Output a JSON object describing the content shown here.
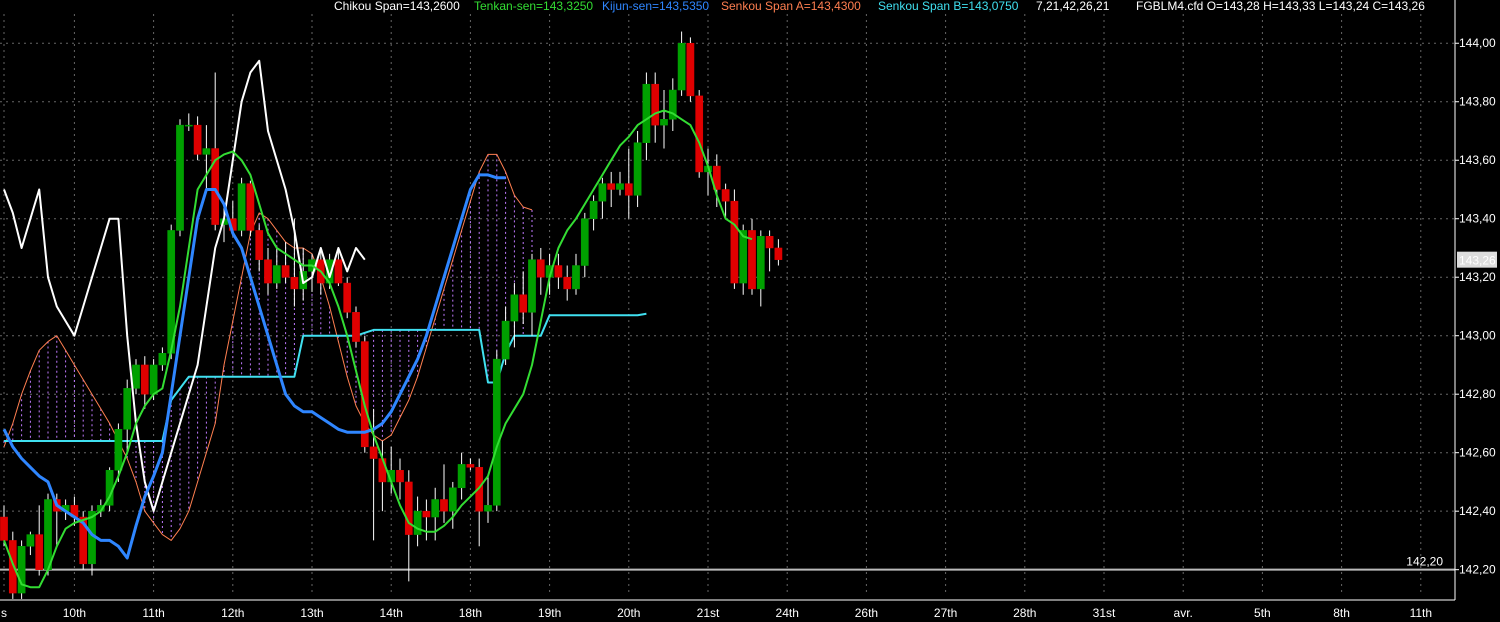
{
  "header": {
    "chikou": "Chikou Span=143,2600",
    "tenkan": "Tenkan-sen=143,3250",
    "kijun": "Kijun-sen=143,5350",
    "senkou_a": "Senkou Span A=143,4300",
    "senkou_b": "Senkou Span B=143,0750",
    "params": "7,21,42,26,21",
    "symbol_ohlc": "FGBLM4.cfd O=143,28 H=143,33 L=143,24 C=143,26"
  },
  "colors": {
    "background": "#000000",
    "up_candle": "#00a000",
    "down_candle": "#e00000",
    "chikou": "#ffffff",
    "tenkan": "#33dd33",
    "kijun": "#2f86ff",
    "senkou_a": "#ff7f50",
    "senkou_b": "#40e0f0",
    "cloud_hatch": "#c07aff",
    "grid": "#666666",
    "horizontal_line": "#bbbbbb"
  },
  "chart_data": {
    "type": "candlestick",
    "ylim": [
      142.11,
      144.1
    ],
    "y_ticks": [
      "144,00",
      "143,80",
      "143,60",
      "143,40",
      "143,20",
      "143,00",
      "142,80",
      "142,60",
      "142,40",
      "142,20"
    ],
    "y_tick_values": [
      144.0,
      143.8,
      143.6,
      143.4,
      143.2,
      143.0,
      142.8,
      142.6,
      142.4,
      142.2
    ],
    "x_labels": [
      "s",
      "10th",
      "11th",
      "12th",
      "13th",
      "14th",
      "18th",
      "19th",
      "20th",
      "21st",
      "24th",
      "26th",
      "27th",
      "28th",
      "31st",
      "avr.",
      "5th",
      "8th",
      "11th"
    ],
    "x_label_index": [
      0,
      8,
      17,
      26,
      35,
      44,
      53,
      62,
      71,
      80,
      89,
      98,
      107,
      116,
      125,
      134,
      143,
      152,
      161
    ],
    "bar_count": 165,
    "current_price_label": "143,26",
    "current_price": 143.26,
    "horizontal_line": {
      "value": 142.2,
      "label": "142,20"
    },
    "candles": [
      [
        142.38,
        142.42,
        142.28,
        142.3
      ],
      [
        142.3,
        142.33,
        142.1,
        142.12
      ],
      [
        142.12,
        142.3,
        142.1,
        142.28
      ],
      [
        142.28,
        142.33,
        142.25,
        142.32
      ],
      [
        142.32,
        142.42,
        142.18,
        142.2
      ],
      [
        142.2,
        142.46,
        142.18,
        142.44
      ],
      [
        142.44,
        142.46,
        142.28,
        142.4
      ],
      [
        142.4,
        142.44,
        142.37,
        142.42
      ],
      [
        142.42,
        142.45,
        142.35,
        142.38
      ],
      [
        142.38,
        142.4,
        142.2,
        142.22
      ],
      [
        142.22,
        142.42,
        142.18,
        142.4
      ],
      [
        142.4,
        142.44,
        142.38,
        142.42
      ],
      [
        142.42,
        142.55,
        142.4,
        142.54
      ],
      [
        142.54,
        142.7,
        142.5,
        142.68
      ],
      [
        142.68,
        142.85,
        142.6,
        142.82
      ],
      [
        142.82,
        142.92,
        142.8,
        142.9
      ],
      [
        142.9,
        142.93,
        142.75,
        142.8
      ],
      [
        142.8,
        142.92,
        142.78,
        142.9
      ],
      [
        142.9,
        142.96,
        142.88,
        142.94
      ],
      [
        142.94,
        143.38,
        142.92,
        143.36
      ],
      [
        143.36,
        143.74,
        143.34,
        143.72
      ],
      [
        143.72,
        143.76,
        143.7,
        143.72
      ],
      [
        143.72,
        143.75,
        143.6,
        143.62
      ],
      [
        143.62,
        143.72,
        143.5,
        143.64
      ],
      [
        143.64,
        143.9,
        143.36,
        143.38
      ],
      [
        143.38,
        143.44,
        143.32,
        143.4
      ],
      [
        143.4,
        143.46,
        143.34,
        143.36
      ],
      [
        143.36,
        143.54,
        143.34,
        143.52
      ],
      [
        143.52,
        143.53,
        143.34,
        143.36
      ],
      [
        143.36,
        143.38,
        143.22,
        143.26
      ],
      [
        143.26,
        143.3,
        143.14,
        143.18
      ],
      [
        143.18,
        143.3,
        143.16,
        143.24
      ],
      [
        143.24,
        143.32,
        143.18,
        143.2
      ],
      [
        143.2,
        143.4,
        143.1,
        143.16
      ],
      [
        143.16,
        143.3,
        143.12,
        143.22
      ],
      [
        143.22,
        143.28,
        143.15,
        143.26
      ],
      [
        143.26,
        143.3,
        143.14,
        143.18
      ],
      [
        143.18,
        143.28,
        143.16,
        143.26
      ],
      [
        143.26,
        143.29,
        143.17,
        143.18
      ],
      [
        143.18,
        143.2,
        143.06,
        143.08
      ],
      [
        143.08,
        143.1,
        142.96,
        142.98
      ],
      [
        142.98,
        143.0,
        142.6,
        142.62
      ],
      [
        142.62,
        142.75,
        142.3,
        142.58
      ],
      [
        142.58,
        142.64,
        142.4,
        142.5
      ],
      [
        142.5,
        142.62,
        142.46,
        142.54
      ],
      [
        142.54,
        142.58,
        142.44,
        142.5
      ],
      [
        142.5,
        142.54,
        142.16,
        142.32
      ],
      [
        142.32,
        142.45,
        142.28,
        142.4
      ],
      [
        142.4,
        142.44,
        142.3,
        142.38
      ],
      [
        142.38,
        142.48,
        142.3,
        142.44
      ],
      [
        142.44,
        142.56,
        142.36,
        142.4
      ],
      [
        142.4,
        142.5,
        142.34,
        142.48
      ],
      [
        142.48,
        142.6,
        142.44,
        142.56
      ],
      [
        142.56,
        142.58,
        142.54,
        142.55
      ],
      [
        142.55,
        142.58,
        142.28,
        142.4
      ],
      [
        142.4,
        142.52,
        142.36,
        142.42
      ],
      [
        142.42,
        142.95,
        142.4,
        142.92
      ],
      [
        142.92,
        143.1,
        142.9,
        143.05
      ],
      [
        143.05,
        143.18,
        142.96,
        143.14
      ],
      [
        143.14,
        143.22,
        143.04,
        143.08
      ],
      [
        143.08,
        143.28,
        143.0,
        143.26
      ],
      [
        143.26,
        143.3,
        143.14,
        143.2
      ],
      [
        143.2,
        143.28,
        143.14,
        143.24
      ],
      [
        143.24,
        143.28,
        143.16,
        143.2
      ],
      [
        143.2,
        143.24,
        143.12,
        143.16
      ],
      [
        143.16,
        143.28,
        143.14,
        143.24
      ],
      [
        143.24,
        143.42,
        143.2,
        143.4
      ],
      [
        143.4,
        143.48,
        143.36,
        143.46
      ],
      [
        143.46,
        143.54,
        143.4,
        143.52
      ],
      [
        143.52,
        143.56,
        143.44,
        143.5
      ],
      [
        143.5,
        143.56,
        143.48,
        143.52
      ],
      [
        143.52,
        143.64,
        143.4,
        143.48
      ],
      [
        143.48,
        143.7,
        143.44,
        143.66
      ],
      [
        143.66,
        143.9,
        143.6,
        143.86
      ],
      [
        143.86,
        143.9,
        143.66,
        143.72
      ],
      [
        143.72,
        143.84,
        143.64,
        143.74
      ],
      [
        143.74,
        143.88,
        143.7,
        143.84
      ],
      [
        143.84,
        144.04,
        143.82,
        144.0
      ],
      [
        144.0,
        144.02,
        143.8,
        143.82
      ],
      [
        143.82,
        143.84,
        143.54,
        143.56
      ],
      [
        143.56,
        143.64,
        143.48,
        143.58
      ],
      [
        143.58,
        143.62,
        143.44,
        143.5
      ],
      [
        143.5,
        143.52,
        143.4,
        143.46
      ],
      [
        143.46,
        143.5,
        143.16,
        143.18
      ],
      [
        143.18,
        143.38,
        143.14,
        143.36
      ],
      [
        143.36,
        143.4,
        143.14,
        143.16
      ],
      [
        143.16,
        143.36,
        143.1,
        143.34
      ],
      [
        143.34,
        143.36,
        143.22,
        143.3
      ],
      [
        143.3,
        143.33,
        143.24,
        143.26
      ]
    ],
    "candle_start_index": 0,
    "tenkan_sen": [
      142.3,
      142.22,
      142.15,
      142.14,
      142.14,
      142.2,
      142.28,
      142.34,
      142.36,
      142.37,
      142.38,
      142.4,
      142.45,
      142.52,
      142.6,
      142.7,
      142.76,
      142.8,
      142.82,
      142.95,
      143.1,
      143.3,
      143.5,
      143.55,
      143.6,
      143.62,
      143.63,
      143.6,
      143.55,
      143.45,
      143.35,
      143.3,
      143.28,
      143.26,
      143.24,
      143.24,
      143.22,
      143.18,
      143.1,
      143.0,
      142.88,
      142.76,
      142.66,
      142.58,
      142.5,
      142.42,
      142.36,
      142.34,
      142.33,
      142.33,
      142.35,
      142.38,
      142.42,
      142.45,
      142.48,
      142.52,
      142.62,
      142.7,
      142.75,
      142.8,
      142.9,
      143.05,
      143.2,
      143.3,
      143.36,
      143.4,
      143.45,
      143.5,
      143.55,
      143.6,
      143.65,
      143.68,
      143.72,
      143.74,
      143.76,
      143.77,
      143.76,
      143.74,
      143.72,
      143.66,
      143.58,
      143.48,
      143.4,
      143.38,
      143.34,
      143.33
    ],
    "tenkan_start_index": 0,
    "kijun_sen": [
      142.68,
      142.62,
      142.58,
      142.55,
      142.52,
      142.5,
      142.42,
      142.4,
      142.38,
      142.36,
      142.32,
      142.3,
      142.3,
      142.28,
      142.24,
      142.35,
      142.45,
      142.52,
      142.6,
      142.8,
      143.0,
      143.2,
      143.4,
      143.5,
      143.5,
      143.45,
      143.35,
      143.3,
      143.2,
      143.1,
      143.0,
      142.9,
      142.8,
      142.76,
      142.74,
      142.74,
      142.72,
      142.7,
      142.68,
      142.67,
      142.67,
      142.67,
      142.68,
      142.7,
      142.74,
      142.8,
      142.86,
      142.92,
      143.0,
      143.1,
      143.2,
      143.3,
      143.4,
      143.5,
      143.55,
      143.55,
      143.54,
      143.54
    ],
    "kijun_start_index": 0,
    "chikou_span": [
      143.5,
      143.42,
      143.3,
      143.4,
      143.5,
      143.2,
      143.1,
      143.05,
      143.0,
      143.1,
      143.2,
      143.3,
      143.4,
      143.4,
      143.0,
      142.7,
      142.5,
      142.4,
      142.5,
      142.6,
      142.7,
      142.8,
      142.9,
      143.1,
      143.3,
      143.4,
      143.6,
      143.8,
      143.9,
      143.94,
      143.7,
      143.6,
      143.5,
      143.36,
      143.18,
      143.2,
      143.3,
      143.2,
      143.3,
      143.22,
      143.3,
      143.26
    ],
    "chikou_start_index": 0,
    "senkou_a": [
      142.62,
      142.7,
      142.8,
      142.88,
      142.95,
      142.98,
      143.0,
      142.95,
      142.9,
      142.85,
      142.8,
      142.75,
      142.7,
      142.64,
      142.58,
      142.5,
      142.4,
      142.36,
      142.32,
      142.3,
      142.34,
      142.4,
      142.5,
      142.6,
      142.7,
      142.9,
      143.05,
      143.2,
      143.35,
      143.42,
      143.4,
      143.36,
      143.32,
      143.3,
      143.3,
      143.28,
      143.2,
      143.1,
      142.98,
      142.86,
      142.76,
      142.7,
      142.66,
      142.64,
      142.66,
      142.72,
      142.78,
      142.86,
      142.96,
      143.06,
      143.16,
      143.26,
      143.36,
      143.46,
      143.56,
      143.62,
      143.62,
      143.56,
      143.48,
      143.44,
      143.43
    ],
    "senkou_a_start_index": 0,
    "senkou_b": [
      142.64,
      142.64,
      142.64,
      142.64,
      142.64,
      142.64,
      142.64,
      142.64,
      142.64,
      142.64,
      142.64,
      142.64,
      142.64,
      142.64,
      142.64,
      142.64,
      142.64,
      142.64,
      142.64,
      142.78,
      142.82,
      142.86,
      142.86,
      142.86,
      142.86,
      142.86,
      142.86,
      142.86,
      142.86,
      142.86,
      142.86,
      142.86,
      142.86,
      142.86,
      143.0,
      143.0,
      143.0,
      143.0,
      143.0,
      143.0,
      143.0,
      143.01,
      143.02,
      143.02,
      143.02,
      143.02,
      143.02,
      143.02,
      143.02,
      143.02,
      143.02,
      143.02,
      143.02,
      143.02,
      143.02,
      142.84,
      142.84,
      142.94,
      143.0,
      143.0,
      143.0,
      143.0,
      143.07,
      143.07,
      143.07,
      143.07,
      143.07,
      143.07,
      143.07,
      143.07,
      143.07,
      143.07,
      143.07,
      143.075
    ],
    "senkou_b_start_index": 0
  }
}
